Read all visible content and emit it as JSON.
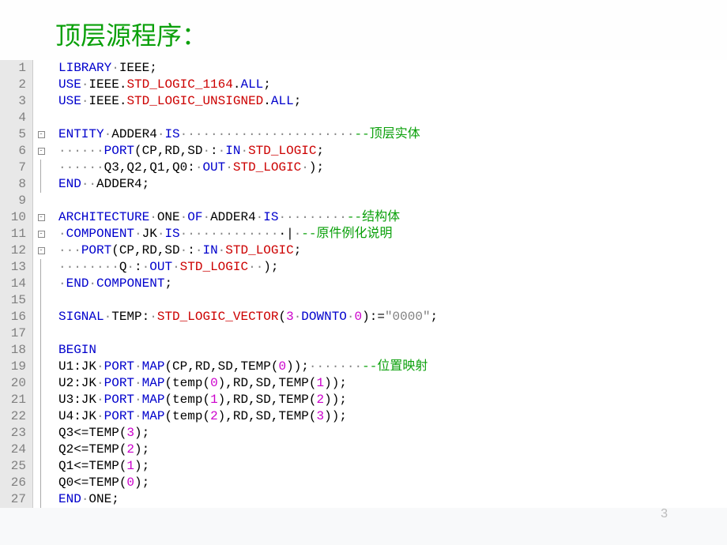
{
  "title": "顶层源程序：",
  "lines": [
    {
      "n": 1,
      "fold": "",
      "tokens": [
        {
          "c": "kw",
          "t": "LIBRARY"
        },
        {
          "c": "dot",
          "t": "·"
        },
        {
          "c": "txt",
          "t": "IEEE;"
        }
      ]
    },
    {
      "n": 2,
      "fold": "",
      "tokens": [
        {
          "c": "kw",
          "t": "USE"
        },
        {
          "c": "dot",
          "t": "·"
        },
        {
          "c": "txt",
          "t": "IEEE."
        },
        {
          "c": "type",
          "t": "STD_LOGIC_1164"
        },
        {
          "c": "txt",
          "t": "."
        },
        {
          "c": "kw",
          "t": "ALL"
        },
        {
          "c": "txt",
          "t": ";"
        }
      ]
    },
    {
      "n": 3,
      "fold": "",
      "tokens": [
        {
          "c": "kw",
          "t": "USE"
        },
        {
          "c": "dot",
          "t": "·"
        },
        {
          "c": "txt",
          "t": "IEEE."
        },
        {
          "c": "type",
          "t": "STD_LOGIC_UNSIGNED"
        },
        {
          "c": "txt",
          "t": "."
        },
        {
          "c": "kw",
          "t": "ALL"
        },
        {
          "c": "txt",
          "t": ";"
        }
      ]
    },
    {
      "n": 4,
      "fold": "",
      "tokens": []
    },
    {
      "n": 5,
      "fold": "box",
      "tokens": [
        {
          "c": "kw",
          "t": "ENTITY"
        },
        {
          "c": "dot",
          "t": "·"
        },
        {
          "c": "txt",
          "t": "ADDER4"
        },
        {
          "c": "dot",
          "t": "·"
        },
        {
          "c": "kw",
          "t": "IS"
        },
        {
          "c": "dot",
          "t": "·······················"
        },
        {
          "c": "cmt",
          "t": "--顶层实体"
        }
      ]
    },
    {
      "n": 6,
      "fold": "box",
      "tokens": [
        {
          "c": "dot",
          "t": "······"
        },
        {
          "c": "kw",
          "t": "PORT"
        },
        {
          "c": "txt",
          "t": "(CP,RD,SD"
        },
        {
          "c": "dot",
          "t": "·"
        },
        {
          "c": "txt",
          "t": ":"
        },
        {
          "c": "dot",
          "t": "·"
        },
        {
          "c": "kw",
          "t": "IN"
        },
        {
          "c": "dot",
          "t": "·"
        },
        {
          "c": "type",
          "t": "STD_LOGIC"
        },
        {
          "c": "txt",
          "t": ";"
        }
      ]
    },
    {
      "n": 7,
      "fold": "line",
      "tokens": [
        {
          "c": "dot",
          "t": "······"
        },
        {
          "c": "txt",
          "t": "Q3,Q2,Q1,Q0:"
        },
        {
          "c": "dot",
          "t": "·"
        },
        {
          "c": "kw",
          "t": "OUT"
        },
        {
          "c": "dot",
          "t": "·"
        },
        {
          "c": "type",
          "t": "STD_LOGIC"
        },
        {
          "c": "dot",
          "t": "·"
        },
        {
          "c": "txt",
          "t": ");"
        }
      ]
    },
    {
      "n": 8,
      "fold": "line",
      "tokens": [
        {
          "c": "kw",
          "t": "END"
        },
        {
          "c": "dot",
          "t": "··"
        },
        {
          "c": "txt",
          "t": "ADDER4;"
        }
      ]
    },
    {
      "n": 9,
      "fold": "",
      "tokens": []
    },
    {
      "n": 10,
      "fold": "box",
      "tokens": [
        {
          "c": "kw",
          "t": "ARCHITECTURE"
        },
        {
          "c": "dot",
          "t": "·"
        },
        {
          "c": "txt",
          "t": "ONE"
        },
        {
          "c": "dot",
          "t": "·"
        },
        {
          "c": "kw",
          "t": "OF"
        },
        {
          "c": "dot",
          "t": "·"
        },
        {
          "c": "txt",
          "t": "ADDER4"
        },
        {
          "c": "dot",
          "t": "·"
        },
        {
          "c": "kw",
          "t": "IS"
        },
        {
          "c": "dot",
          "t": "·········"
        },
        {
          "c": "cmt",
          "t": "--结构体"
        }
      ]
    },
    {
      "n": 11,
      "fold": "box",
      "tokens": [
        {
          "c": "dot",
          "t": "·"
        },
        {
          "c": "kw",
          "t": "COMPONENT"
        },
        {
          "c": "dot",
          "t": "·"
        },
        {
          "c": "txt",
          "t": "JK"
        },
        {
          "c": "dot",
          "t": "·"
        },
        {
          "c": "kw",
          "t": "IS"
        },
        {
          "c": "dot",
          "t": "·············"
        },
        {
          "c": "txt",
          "t": "·|"
        },
        {
          "c": "dot",
          "t": "·"
        },
        {
          "c": "cmt",
          "t": "--原件例化说明"
        }
      ]
    },
    {
      "n": 12,
      "fold": "box",
      "tokens": [
        {
          "c": "dot",
          "t": "···"
        },
        {
          "c": "kw",
          "t": "PORT"
        },
        {
          "c": "txt",
          "t": "(CP,RD,SD"
        },
        {
          "c": "dot",
          "t": "·"
        },
        {
          "c": "txt",
          "t": ":"
        },
        {
          "c": "dot",
          "t": "·"
        },
        {
          "c": "kw",
          "t": "IN"
        },
        {
          "c": "dot",
          "t": "·"
        },
        {
          "c": "type",
          "t": "STD_LOGIC"
        },
        {
          "c": "txt",
          "t": ";"
        }
      ]
    },
    {
      "n": 13,
      "fold": "line",
      "tokens": [
        {
          "c": "dot",
          "t": "········"
        },
        {
          "c": "txt",
          "t": "Q"
        },
        {
          "c": "dot",
          "t": "·"
        },
        {
          "c": "txt",
          "t": ":"
        },
        {
          "c": "dot",
          "t": "·"
        },
        {
          "c": "kw",
          "t": "OUT"
        },
        {
          "c": "dot",
          "t": "·"
        },
        {
          "c": "type",
          "t": "STD_LOGIC"
        },
        {
          "c": "dot",
          "t": "··"
        },
        {
          "c": "txt",
          "t": ");"
        }
      ]
    },
    {
      "n": 14,
      "fold": "line",
      "tokens": [
        {
          "c": "dot",
          "t": "·"
        },
        {
          "c": "kw",
          "t": "END"
        },
        {
          "c": "dot",
          "t": "·"
        },
        {
          "c": "kw",
          "t": "COMPONENT"
        },
        {
          "c": "txt",
          "t": ";"
        }
      ]
    },
    {
      "n": 15,
      "fold": "line",
      "tokens": []
    },
    {
      "n": 16,
      "fold": "line",
      "tokens": [
        {
          "c": "kw",
          "t": "SIGNAL"
        },
        {
          "c": "dot",
          "t": "·"
        },
        {
          "c": "txt",
          "t": "TEMP:"
        },
        {
          "c": "dot",
          "t": "·"
        },
        {
          "c": "type",
          "t": "STD_LOGIC_VECTOR"
        },
        {
          "c": "txt",
          "t": "("
        },
        {
          "c": "num",
          "t": "3"
        },
        {
          "c": "dot",
          "t": "·"
        },
        {
          "c": "kw",
          "t": "DOWNTO"
        },
        {
          "c": "dot",
          "t": "·"
        },
        {
          "c": "num",
          "t": "0"
        },
        {
          "c": "txt",
          "t": "):="
        },
        {
          "c": "str",
          "t": "\"0000\""
        },
        {
          "c": "txt",
          "t": ";"
        }
      ]
    },
    {
      "n": 17,
      "fold": "line",
      "tokens": []
    },
    {
      "n": 18,
      "fold": "line",
      "tokens": [
        {
          "c": "kw",
          "t": "BEGIN"
        }
      ]
    },
    {
      "n": 19,
      "fold": "line",
      "tokens": [
        {
          "c": "txt",
          "t": "U1:JK"
        },
        {
          "c": "dot",
          "t": "·"
        },
        {
          "c": "kw",
          "t": "PORT"
        },
        {
          "c": "dot",
          "t": "·"
        },
        {
          "c": "kw",
          "t": "MAP"
        },
        {
          "c": "txt",
          "t": "(CP,RD,SD,TEMP("
        },
        {
          "c": "num",
          "t": "0"
        },
        {
          "c": "txt",
          "t": "));"
        },
        {
          "c": "dot",
          "t": "·······"
        },
        {
          "c": "cmt",
          "t": "--位置映射"
        }
      ]
    },
    {
      "n": 20,
      "fold": "line",
      "tokens": [
        {
          "c": "txt",
          "t": "U2:JK"
        },
        {
          "c": "dot",
          "t": "·"
        },
        {
          "c": "kw",
          "t": "PORT"
        },
        {
          "c": "dot",
          "t": "·"
        },
        {
          "c": "kw",
          "t": "MAP"
        },
        {
          "c": "txt",
          "t": "(temp("
        },
        {
          "c": "num",
          "t": "0"
        },
        {
          "c": "txt",
          "t": "),RD,SD,TEMP("
        },
        {
          "c": "num",
          "t": "1"
        },
        {
          "c": "txt",
          "t": "));"
        }
      ]
    },
    {
      "n": 21,
      "fold": "line",
      "tokens": [
        {
          "c": "txt",
          "t": "U3:JK"
        },
        {
          "c": "dot",
          "t": "·"
        },
        {
          "c": "kw",
          "t": "PORT"
        },
        {
          "c": "dot",
          "t": "·"
        },
        {
          "c": "kw",
          "t": "MAP"
        },
        {
          "c": "txt",
          "t": "(temp("
        },
        {
          "c": "num",
          "t": "1"
        },
        {
          "c": "txt",
          "t": "),RD,SD,TEMP("
        },
        {
          "c": "num",
          "t": "2"
        },
        {
          "c": "txt",
          "t": "));"
        }
      ]
    },
    {
      "n": 22,
      "fold": "line",
      "tokens": [
        {
          "c": "txt",
          "t": "U4:JK"
        },
        {
          "c": "dot",
          "t": "·"
        },
        {
          "c": "kw",
          "t": "PORT"
        },
        {
          "c": "dot",
          "t": "·"
        },
        {
          "c": "kw",
          "t": "MAP"
        },
        {
          "c": "txt",
          "t": "(temp("
        },
        {
          "c": "num",
          "t": "2"
        },
        {
          "c": "txt",
          "t": "),RD,SD,TEMP("
        },
        {
          "c": "num",
          "t": "3"
        },
        {
          "c": "txt",
          "t": "));"
        }
      ]
    },
    {
      "n": 23,
      "fold": "line",
      "tokens": [
        {
          "c": "txt",
          "t": "Q3<=TEMP("
        },
        {
          "c": "num",
          "t": "3"
        },
        {
          "c": "txt",
          "t": ");"
        }
      ]
    },
    {
      "n": 24,
      "fold": "line",
      "tokens": [
        {
          "c": "txt",
          "t": "Q2<=TEMP("
        },
        {
          "c": "num",
          "t": "2"
        },
        {
          "c": "txt",
          "t": ");"
        }
      ]
    },
    {
      "n": 25,
      "fold": "line",
      "tokens": [
        {
          "c": "txt",
          "t": "Q1<=TEMP("
        },
        {
          "c": "num",
          "t": "1"
        },
        {
          "c": "txt",
          "t": ");"
        }
      ]
    },
    {
      "n": 26,
      "fold": "line",
      "tokens": [
        {
          "c": "txt",
          "t": "Q0<=TEMP("
        },
        {
          "c": "num",
          "t": "0"
        },
        {
          "c": "txt",
          "t": ");"
        }
      ]
    },
    {
      "n": 27,
      "fold": "line",
      "tokens": [
        {
          "c": "kw",
          "t": "END"
        },
        {
          "c": "dot",
          "t": "·"
        },
        {
          "c": "txt",
          "t": "ONE;"
        }
      ]
    }
  ],
  "page_number": "3"
}
